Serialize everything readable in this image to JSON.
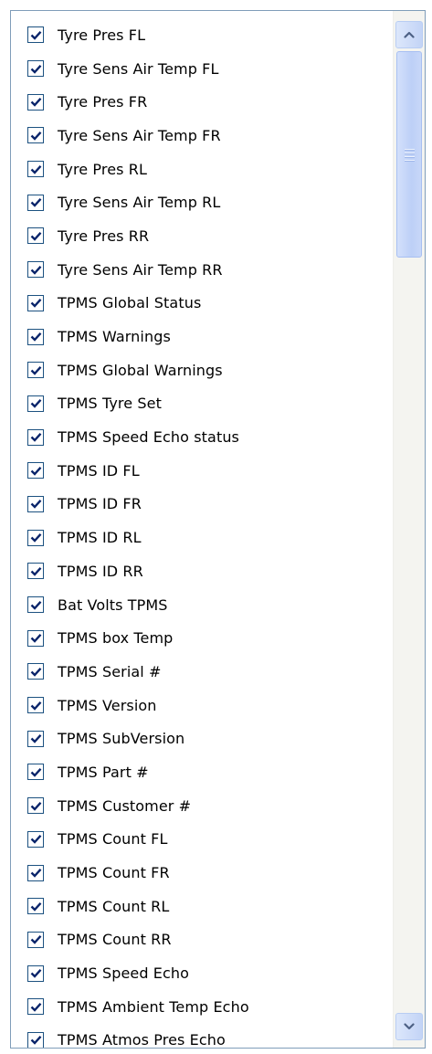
{
  "items": [
    {
      "label": "Tyre Pres FL",
      "checked": true
    },
    {
      "label": "Tyre Sens Air Temp FL",
      "checked": true
    },
    {
      "label": "Tyre Pres FR",
      "checked": true
    },
    {
      "label": "Tyre Sens Air Temp FR",
      "checked": true
    },
    {
      "label": "Tyre Pres RL",
      "checked": true
    },
    {
      "label": "Tyre Sens Air Temp RL",
      "checked": true
    },
    {
      "label": "Tyre Pres RR",
      "checked": true
    },
    {
      "label": "Tyre Sens Air Temp RR",
      "checked": true
    },
    {
      "label": "TPMS Global Status",
      "checked": true
    },
    {
      "label": "TPMS Warnings",
      "checked": true
    },
    {
      "label": "TPMS Global Warnings",
      "checked": true
    },
    {
      "label": "TPMS Tyre Set",
      "checked": true
    },
    {
      "label": "TPMS Speed Echo status",
      "checked": true
    },
    {
      "label": "TPMS ID FL",
      "checked": true
    },
    {
      "label": "TPMS ID FR",
      "checked": true
    },
    {
      "label": "TPMS ID RL",
      "checked": true
    },
    {
      "label": "TPMS ID RR",
      "checked": true
    },
    {
      "label": "Bat Volts TPMS",
      "checked": true
    },
    {
      "label": "TPMS box Temp",
      "checked": true
    },
    {
      "label": "TPMS Serial #",
      "checked": true
    },
    {
      "label": "TPMS Version",
      "checked": true
    },
    {
      "label": "TPMS SubVersion",
      "checked": true
    },
    {
      "label": "TPMS Part #",
      "checked": true
    },
    {
      "label": "TPMS Customer #",
      "checked": true
    },
    {
      "label": "TPMS Count FL",
      "checked": true
    },
    {
      "label": "TPMS Count FR",
      "checked": true
    },
    {
      "label": "TPMS Count RL",
      "checked": true
    },
    {
      "label": "TPMS Count RR",
      "checked": true
    },
    {
      "label": "TPMS Speed Echo",
      "checked": true
    },
    {
      "label": "TPMS Ambient Temp Echo",
      "checked": true
    },
    {
      "label": "TPMS Atmos Pres Echo",
      "checked": true
    }
  ],
  "scrollbar": {
    "up_icon": "chevron-up-icon",
    "down_icon": "chevron-down-icon",
    "thumb_position": 0.0,
    "visible_fraction": 0.22
  },
  "colors": {
    "border": "#7f9db9",
    "check": "#0a246a",
    "scroll_accent": "#4d6185"
  }
}
